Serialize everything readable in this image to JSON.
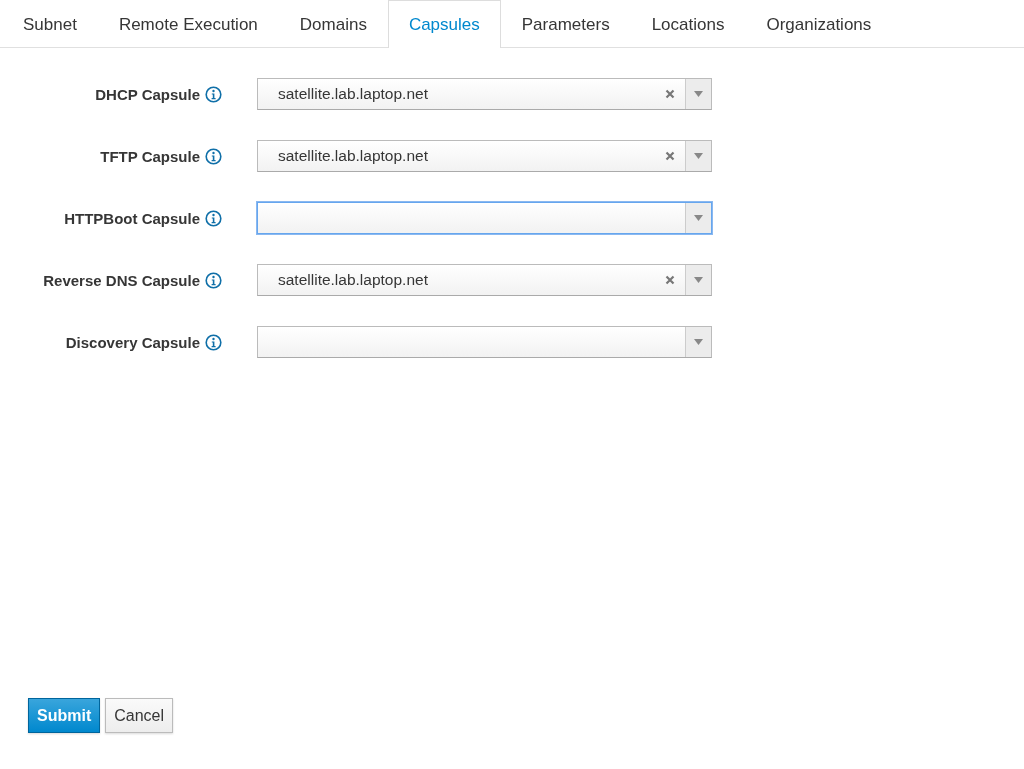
{
  "tabs": [
    {
      "label": "Subnet",
      "selected": false
    },
    {
      "label": "Remote Execution",
      "selected": false
    },
    {
      "label": "Domains",
      "selected": false
    },
    {
      "label": "Capsules",
      "selected": true
    },
    {
      "label": "Parameters",
      "selected": false
    },
    {
      "label": "Locations",
      "selected": false
    },
    {
      "label": "Organizations",
      "selected": false
    }
  ],
  "fields": [
    {
      "label": "DHCP Capsule",
      "value": "satellite.lab.laptop.net",
      "focused": false
    },
    {
      "label": "TFTP Capsule",
      "value": "satellite.lab.laptop.net",
      "focused": false
    },
    {
      "label": "HTTPBoot Capsule",
      "focused": true
    },
    {
      "label": "Reverse DNS Capsule",
      "value": "satellite.lab.laptop.net",
      "focused": false
    },
    {
      "label": "Discovery Capsule",
      "focused": false
    }
  ],
  "buttons": [
    {
      "label": "Submit",
      "kind": "primary"
    },
    {
      "label": "Cancel",
      "kind": "default"
    }
  ]
}
